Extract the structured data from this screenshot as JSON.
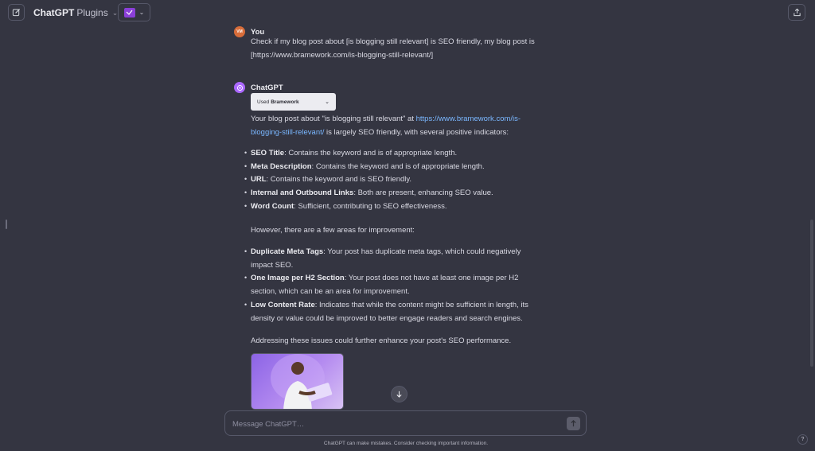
{
  "header": {
    "model_name": "ChatGPT",
    "model_variant": "Plugins",
    "caret": "⌄",
    "plugin_caret": "⌄"
  },
  "user_message": {
    "author": "You",
    "avatar_initials": "VM",
    "line1": "Check if my blog post about [is blogging still relevant] is SEO friendly, my blog post is",
    "line2": "[https://www.bramework.com/is-blogging-still-relevant/]"
  },
  "assistant_message": {
    "author": "ChatGPT",
    "tool_badge": {
      "prefix": "Used",
      "plugin": "Bramework",
      "caret": "⌄"
    },
    "intro": {
      "before_link": "Your blog post about \"is blogging still relevant\" at ",
      "link_part1": "https://www.bramework.com/is-",
      "link_part2": "blogging-still-relevant/",
      "after_link": " is largely SEO friendly, with several positive indicators:"
    },
    "positives": [
      {
        "term": "SEO Title",
        "text": ": Contains the keyword and is of appropriate length."
      },
      {
        "term": "Meta Description",
        "text": ": Contains the keyword and is of appropriate length."
      },
      {
        "term": "URL",
        "text": ": Contains the keyword and is SEO friendly."
      },
      {
        "term": "Internal and Outbound Links",
        "text": ": Both are present, enhancing SEO value."
      },
      {
        "term": "Word Count",
        "text": ": Sufficient, contributing to SEO effectiveness."
      }
    ],
    "improvement_intro": "However, there are a few areas for improvement:",
    "improvements": [
      {
        "term": "Duplicate Meta Tags",
        "text": ": Your post has duplicate meta tags, which could negatively impact SEO."
      },
      {
        "term": "One Image per H2 Section",
        "text": ": Your post does not have at least one image per H2 section, which can be an area for improvement."
      },
      {
        "term": "Low Content Rate",
        "text": ": Indicates that while the content might be sufficient in length, its density or value could be improved to better engage readers and search engines."
      }
    ],
    "closing": "Addressing these issues could further enhance your post's SEO performance."
  },
  "composer": {
    "placeholder": "Message ChatGPT…"
  },
  "footer": {
    "disclaimer": "ChatGPT can make mistakes. Consider checking important information.",
    "help_label": "?"
  },
  "icons": {
    "new_chat": "edit-icon",
    "plugin": "bramework-plugin-icon",
    "share": "share-icon",
    "scroll_down": "arrow-down-icon",
    "send": "arrow-up-icon"
  },
  "colors": {
    "background": "#343541",
    "link": "#7ab7ff",
    "plugin_accent": "#8b3fd9",
    "gpt_avatar": "#ab68ff",
    "user_avatar": "#d86d3a"
  }
}
